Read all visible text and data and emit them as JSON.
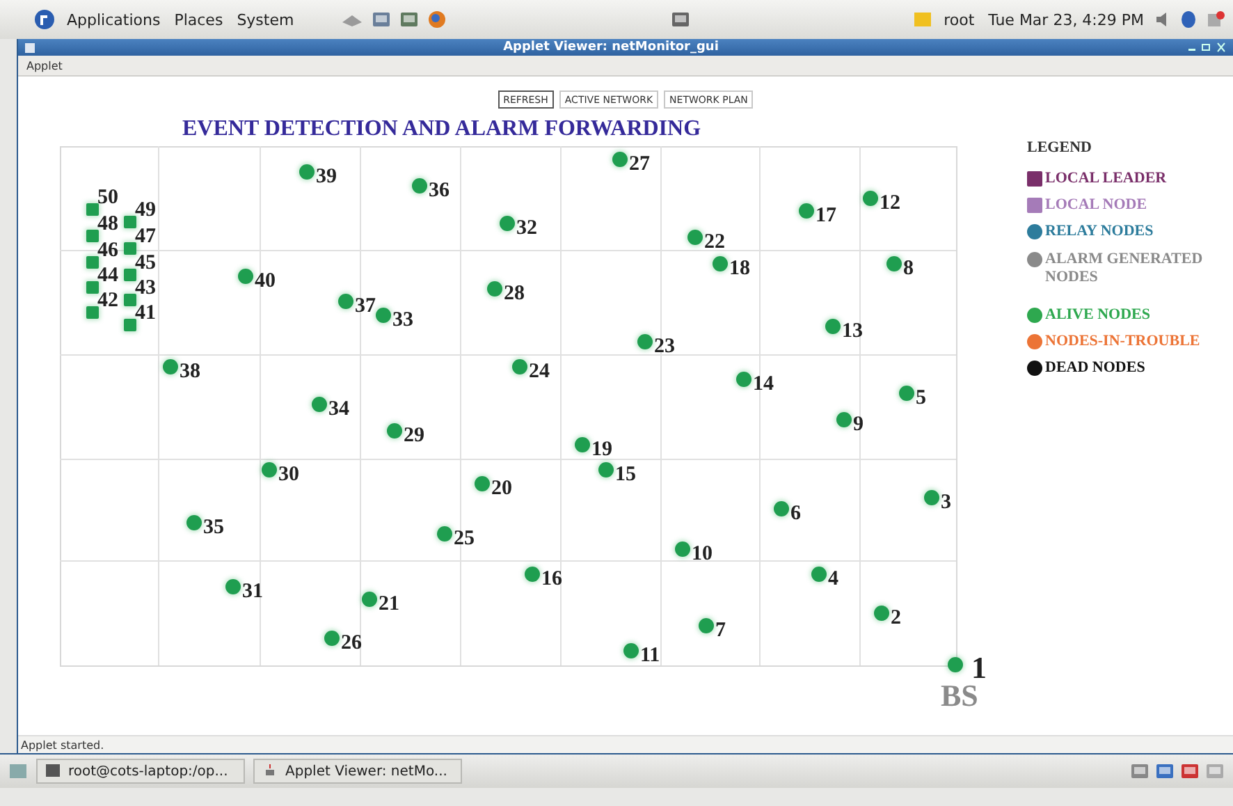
{
  "top_panel": {
    "menus": [
      "Applications",
      "Places",
      "System"
    ],
    "user": "root",
    "clock": "Tue Mar 23,  4:29 PM"
  },
  "window": {
    "title": "Applet Viewer: netMonitor_gui",
    "menu": [
      "Applet"
    ]
  },
  "toolbar": [
    {
      "label": "REFRESH",
      "selected": true
    },
    {
      "label": "ACTIVE NETWORK",
      "selected": false
    },
    {
      "label": "NETWORK PLAN",
      "selected": false
    }
  ],
  "heading": "EVENT DETECTION AND ALARM FORWARDING",
  "legend": {
    "title": "LEGEND",
    "items": [
      {
        "label": "LOCAL LEADER",
        "kind": "square",
        "color": "#7a2f6a"
      },
      {
        "label": "LOCAL NODE",
        "kind": "square",
        "color": "#a57bb8"
      },
      {
        "label": "RELAY NODES",
        "kind": "circle",
        "color": "#2d7c9c"
      },
      {
        "label": "ALARM GENERATED NODES",
        "kind": "circle",
        "color": "#8a8a8a"
      },
      {
        "label": "ALIVE NODES",
        "kind": "circle",
        "color": "#2ea84f"
      },
      {
        "label": "NODES-IN-TROUBLE",
        "kind": "circle",
        "color": "#ec7436"
      },
      {
        "label": "DEAD NODES",
        "kind": "circle",
        "color": "#111111"
      }
    ]
  },
  "nodes": [
    {
      "label": "50",
      "kind": "square",
      "color": "#1f9e50"
    },
    {
      "label": "49",
      "kind": "square",
      "color": "#1f9e50"
    },
    {
      "label": "48",
      "kind": "square",
      "color": "#1f9e50"
    },
    {
      "label": "47",
      "kind": "square",
      "color": "#1f9e50"
    },
    {
      "label": "46",
      "kind": "square",
      "color": "#1f9e50"
    },
    {
      "label": "45",
      "kind": "square",
      "color": "#1f9e50"
    },
    {
      "label": "44",
      "kind": "square",
      "color": "#1f9e50"
    },
    {
      "label": "43",
      "kind": "square",
      "color": "#1f9e50"
    },
    {
      "label": "42",
      "kind": "square",
      "color": "#1f9e50"
    },
    {
      "label": "41",
      "kind": "square",
      "color": "#1f9e50"
    },
    {
      "label": "39",
      "kind": "round",
      "color": "#1f9e50"
    },
    {
      "label": "36",
      "kind": "round",
      "color": "#1f9e50"
    },
    {
      "label": "27",
      "kind": "round",
      "color": "#1f9e50"
    },
    {
      "label": "32",
      "kind": "round",
      "color": "#1f9e50"
    },
    {
      "label": "17",
      "kind": "round",
      "color": "#1f9e50"
    },
    {
      "label": "12",
      "kind": "round",
      "color": "#1f9e50"
    },
    {
      "label": "22",
      "kind": "round",
      "color": "#1f9e50"
    },
    {
      "label": "18",
      "kind": "round",
      "color": "#1f9e50"
    },
    {
      "label": "8",
      "kind": "round",
      "color": "#1f9e50"
    },
    {
      "label": "40",
      "kind": "round",
      "color": "#1f9e50"
    },
    {
      "label": "28",
      "kind": "round",
      "color": "#1f9e50"
    },
    {
      "label": "37",
      "kind": "round",
      "color": "#1f9e50"
    },
    {
      "label": "33",
      "kind": "round",
      "color": "#1f9e50"
    },
    {
      "label": "13",
      "kind": "round",
      "color": "#1f9e50"
    },
    {
      "label": "23",
      "kind": "round",
      "color": "#1f9e50"
    },
    {
      "label": "38",
      "kind": "round",
      "color": "#1f9e50"
    },
    {
      "label": "24",
      "kind": "round",
      "color": "#1f9e50"
    },
    {
      "label": "14",
      "kind": "round",
      "color": "#1f9e50"
    },
    {
      "label": "5",
      "kind": "round",
      "color": "#1f9e50"
    },
    {
      "label": "34",
      "kind": "round",
      "color": "#1f9e50"
    },
    {
      "label": "29",
      "kind": "round",
      "color": "#1f9e50"
    },
    {
      "label": "9",
      "kind": "round",
      "color": "#1f9e50"
    },
    {
      "label": "19",
      "kind": "round",
      "color": "#1f9e50"
    },
    {
      "label": "30",
      "kind": "round",
      "color": "#1f9e50"
    },
    {
      "label": "15",
      "kind": "round",
      "color": "#1f9e50"
    },
    {
      "label": "20",
      "kind": "round",
      "color": "#1f9e50"
    },
    {
      "label": "3",
      "kind": "round",
      "color": "#1f9e50"
    },
    {
      "label": "6",
      "kind": "round",
      "color": "#1f9e50"
    },
    {
      "label": "35",
      "kind": "round",
      "color": "#1f9e50"
    },
    {
      "label": "25",
      "kind": "round",
      "color": "#1f9e50"
    },
    {
      "label": "10",
      "kind": "round",
      "color": "#1f9e50"
    },
    {
      "label": "16",
      "kind": "round",
      "color": "#1f9e50"
    },
    {
      "label": "4",
      "kind": "round",
      "color": "#1f9e50"
    },
    {
      "label": "31",
      "kind": "round",
      "color": "#1f9e50"
    },
    {
      "label": "21",
      "kind": "round",
      "color": "#1f9e50"
    },
    {
      "label": "2",
      "kind": "round",
      "color": "#1f9e50"
    },
    {
      "label": "7",
      "kind": "round",
      "color": "#1f9e50"
    },
    {
      "label": "26",
      "kind": "round",
      "color": "#1f9e50"
    },
    {
      "label": "11",
      "kind": "round",
      "color": "#1f9e50"
    },
    {
      "label": "1",
      "kind": "base_station",
      "color": "#1f9e50",
      "caption": "BS"
    }
  ],
  "status_bar": "Applet started.",
  "taskbar": [
    {
      "label": "root@cots-laptop:/op...",
      "kind": "terminal"
    },
    {
      "label": "Applet Viewer: netMo...",
      "kind": "java"
    }
  ]
}
